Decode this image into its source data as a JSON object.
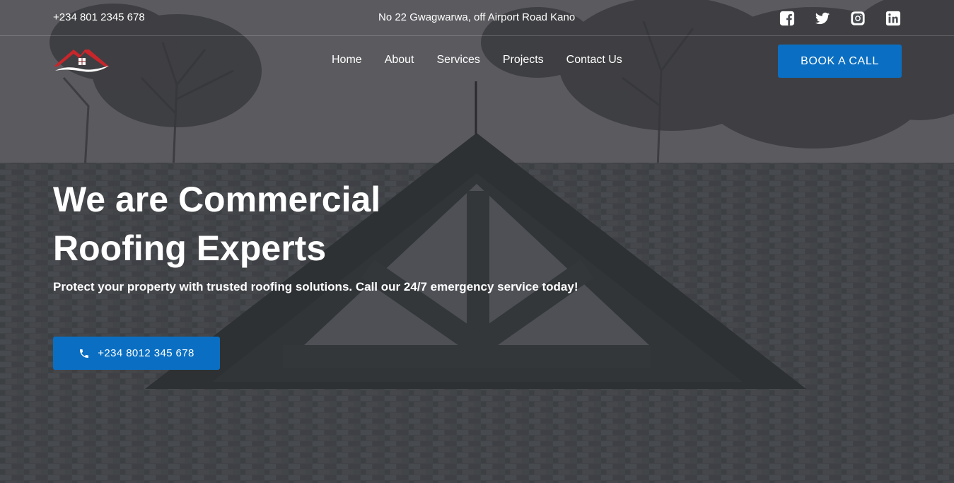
{
  "topbar": {
    "phone": "+234 801 2345 678",
    "address": "No 22 Gwagwarwa, off Airport Road Kano",
    "socials": [
      "facebook-icon",
      "twitter-icon",
      "instagram-icon",
      "linkedin-icon"
    ]
  },
  "nav": {
    "items": [
      {
        "label": "Home"
      },
      {
        "label": "About"
      },
      {
        "label": "Services"
      },
      {
        "label": "Projects"
      },
      {
        "label": "Contact Us"
      }
    ],
    "cta_label": "BOOK A CALL"
  },
  "hero": {
    "headline_line1": "We are Commercial",
    "headline_line2": "Roofing Experts",
    "subheadline": "Protect your property with trusted roofing solutions. Call our 24/7 emergency service today!",
    "call_button_label": "+234 8012 345 678"
  },
  "colors": {
    "accent": "#0a6fc2",
    "logo_red": "#c8262b",
    "overlay": "#3a3d42"
  }
}
